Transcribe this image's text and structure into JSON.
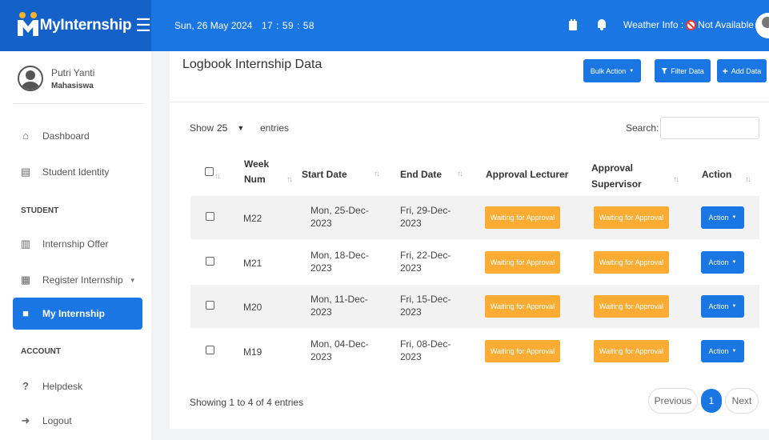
{
  "app": {
    "name": "MyInternship"
  },
  "topbar": {
    "date": "Sun, 26 May 2024",
    "time": "17 : 59 : 58",
    "weather_label": "Weather Info :",
    "weather_value": "Not Available"
  },
  "profile": {
    "name": "Putri Yanti",
    "role": "Mahasiswa"
  },
  "sidebar": {
    "items": [
      {
        "label": "Dashboard",
        "icon": "home-icon"
      },
      {
        "label": "Student Identity",
        "icon": "id-card-icon"
      },
      {
        "label": "Internship Offer",
        "icon": "clipboard-icon"
      },
      {
        "label": "Register Internship",
        "icon": "form-icon"
      },
      {
        "label": "My Internship",
        "icon": "briefcase-icon"
      },
      {
        "label": "Helpdesk",
        "icon": "question-icon"
      },
      {
        "label": "Logout",
        "icon": "logout-icon"
      }
    ],
    "sections": {
      "student": "STUDENT",
      "account": "ACCOUNT"
    }
  },
  "card": {
    "title": "Logbook Internship Data",
    "bulk_action": "Bulk Action",
    "filter_data": "Filter Data",
    "add_data": "Add Data"
  },
  "table_controls": {
    "show_label": "Show",
    "entries_value": "25",
    "entries_label": "entries",
    "search_label": "Search:",
    "search_value": ""
  },
  "table": {
    "headers": {
      "week_num_1": "Week",
      "week_num_2": "Num",
      "start_date": "Start Date",
      "end_date": "End Date",
      "approval_lecturer": "Approval Lecturer",
      "approval_supervisor_1": "Approval",
      "approval_supervisor_2": "Supervisor",
      "action": "Action"
    },
    "rows": [
      {
        "week": "M22",
        "start_1": "Mon, 25-Dec-",
        "start_2": "2023",
        "end_1": "Fri, 29-Dec-",
        "end_2": "2023",
        "lecturer": "Waiting for Approval",
        "supervisor": "Waiting for Approval",
        "action": "Action"
      },
      {
        "week": "M21",
        "start_1": "Mon, 18-Dec-",
        "start_2": "2023",
        "end_1": "Fri, 22-Dec-",
        "end_2": "2023",
        "lecturer": "Waiting for Approval",
        "supervisor": "Waiting for Approval",
        "action": "Action"
      },
      {
        "week": "M20",
        "start_1": "Mon, 11-Dec-",
        "start_2": "2023",
        "end_1": "Fri, 15-Dec-",
        "end_2": "2023",
        "lecturer": "Waiting for Approval",
        "supervisor": "Waiting for Approval",
        "action": "Action"
      },
      {
        "week": "M19",
        "start_1": "Mon, 04-Dec-",
        "start_2": "2023",
        "end_1": "Fri, 08-Dec-",
        "end_2": "2023",
        "lecturer": "Waiting for Approval",
        "supervisor": "Waiting for Approval",
        "action": "Action"
      }
    ]
  },
  "pagination": {
    "info": "Showing 1 to 4 of 4 entries",
    "previous": "Previous",
    "current": "1",
    "next": "Next"
  },
  "colors": {
    "primary": "#1976e3",
    "brand_dark": "#1462c9",
    "warning": "#fcac33",
    "background": "#f2f3f5"
  }
}
